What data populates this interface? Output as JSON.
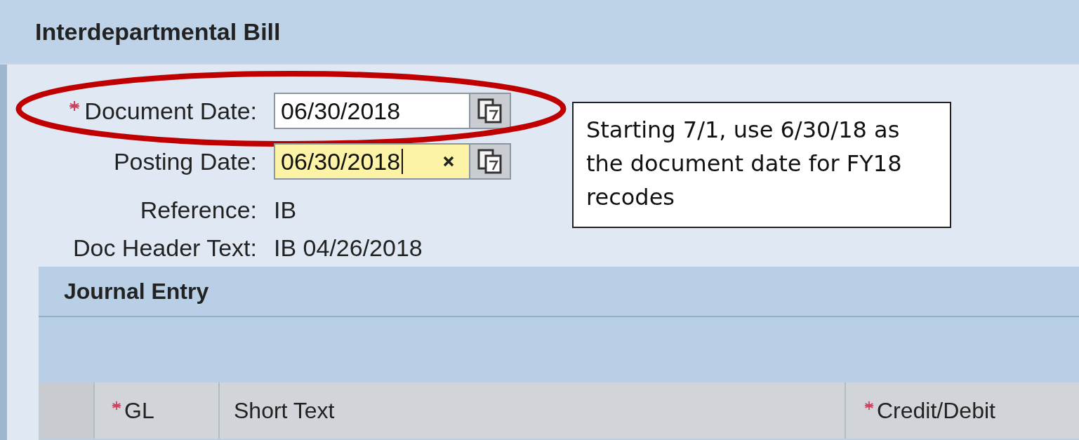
{
  "title": "Interdepartmental Bill",
  "fields": [
    {
      "label": "Document Date:",
      "required": true,
      "kind": "date",
      "value": "06/30/2018",
      "focused": false,
      "highlighted": true
    },
    {
      "label": "Posting Date:",
      "required": false,
      "kind": "date",
      "value": "06/30/2018",
      "focused": true,
      "highlighted": false
    },
    {
      "label": "Reference:",
      "required": false,
      "kind": "text",
      "value": "IB"
    },
    {
      "label": "Doc Header Text:",
      "required": false,
      "kind": "text",
      "value": "IB 04/26/2018"
    }
  ],
  "callout": "Starting 7/1, use 6/30/18 as the document date for FY18 recodes",
  "journal": {
    "title": "Journal Entry",
    "columns": [
      {
        "kind": "selector"
      },
      {
        "kind": "header",
        "label": "GL",
        "required": true
      },
      {
        "kind": "header",
        "label": "Short Text",
        "required": false
      },
      {
        "kind": "header",
        "label": "Credit/Debit",
        "required": true
      }
    ]
  }
}
